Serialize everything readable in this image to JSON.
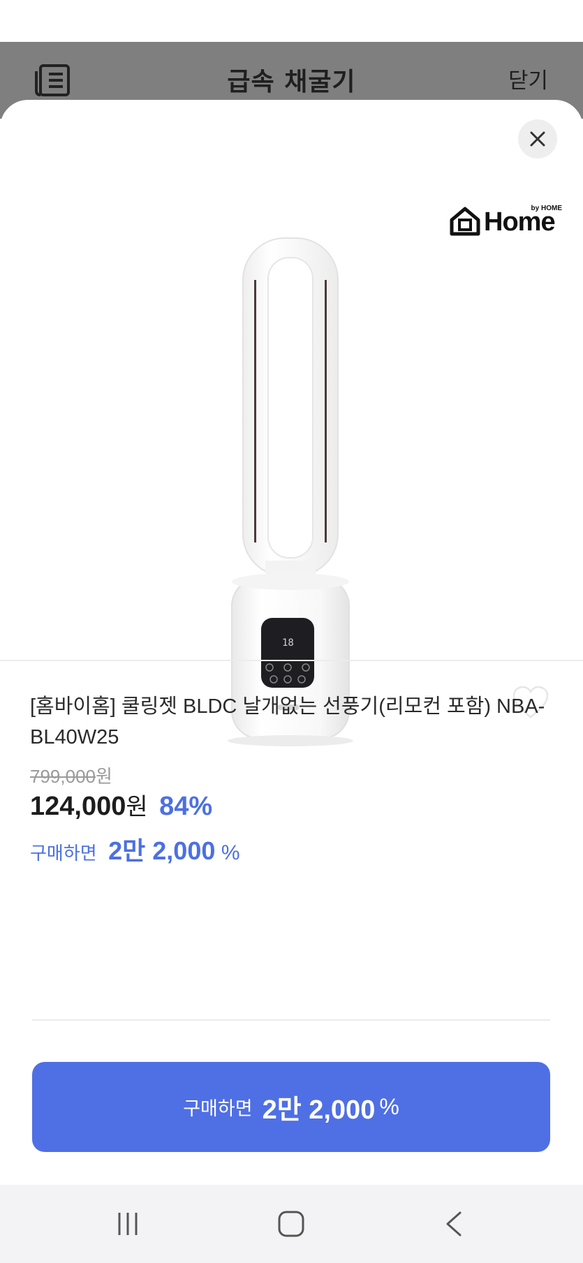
{
  "header": {
    "title": "급속 채굴기",
    "close_label": "닫기",
    "menu_icon": "list-icon"
  },
  "brand": {
    "by_text": "by HOME",
    "word": "Home"
  },
  "product": {
    "title": "[홈바이홈] 쿨링젯 BLDC 날개없는 선풍기(리모컨 포함) NBA-BL40W25",
    "original_price": "799,000",
    "original_price_unit": "원",
    "sale_price": "124,000",
    "sale_price_unit": "원",
    "discount_pct": "84%",
    "buy_label": "구매하면",
    "buy_amount": "2만 2,000",
    "buy_pct": "%",
    "display_readout": "18"
  },
  "cta": {
    "label": "구매하면",
    "amount": "2만 2,000",
    "pct": "%"
  },
  "colors": {
    "accent": "#4f6fe4",
    "accent_text": "#4c70e2",
    "header_bg": "#7f7f7f"
  }
}
